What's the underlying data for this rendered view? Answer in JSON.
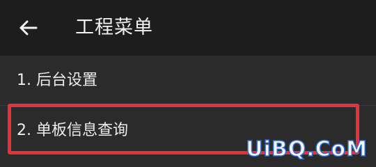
{
  "app_bar": {
    "back_icon": "arrow-left-icon",
    "title": "工程菜单"
  },
  "menu": {
    "items": [
      {
        "label": "1. 后台设置"
      },
      {
        "label": "2. 单板信息查询"
      }
    ]
  },
  "highlight": {
    "color": "#e8323a"
  },
  "watermark": {
    "text": "UiBQ.CoM"
  },
  "colors": {
    "app_bar_bg": "#1d1d1d",
    "list_bg": "#2b2b2b",
    "text": "#ececec"
  }
}
